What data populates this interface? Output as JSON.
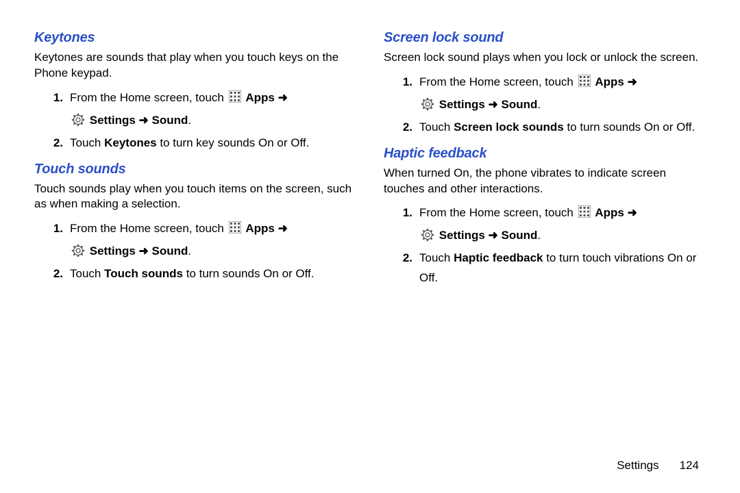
{
  "footer": {
    "section": "Settings",
    "page": "124"
  },
  "arrow": "➜",
  "left": {
    "s1": {
      "heading": "Keytones",
      "desc": "Keytones are sounds that play when you touch keys on the Phone keypad.",
      "step1_prefix": "From the Home screen, touch ",
      "apps_label": "Apps",
      "settings_label": "Settings",
      "sound_label": "Sound",
      "step2_a": "Touch ",
      "step2_bold": "Keytones",
      "step2_b": " to turn key sounds On or Off."
    },
    "s2": {
      "heading": "Touch sounds",
      "desc": "Touch sounds play when you touch items on the screen, such as when making a selection.",
      "step1_prefix": "From the Home screen, touch ",
      "apps_label": "Apps",
      "settings_label": "Settings",
      "sound_label": "Sound",
      "step2_a": "Touch ",
      "step2_bold": "Touch sounds",
      "step2_b": " to turn sounds On or Off."
    }
  },
  "right": {
    "s1": {
      "heading": "Screen lock sound",
      "desc": "Screen lock sound plays when you lock or unlock the screen.",
      "step1_prefix": "From the Home screen, touch ",
      "apps_label": "Apps",
      "settings_label": "Settings",
      "sound_label": "Sound",
      "step2_a": "Touch ",
      "step2_bold": "Screen lock sounds",
      "step2_b": " to turn sounds On or Off."
    },
    "s2": {
      "heading": "Haptic feedback",
      "desc": "When turned On, the phone vibrates to indicate screen touches and other interactions.",
      "step1_prefix": "From the Home screen, touch ",
      "apps_label": "Apps",
      "settings_label": "Settings",
      "sound_label": "Sound",
      "step2_a": "Touch ",
      "step2_bold": "Haptic feedback",
      "step2_b": " to turn touch vibrations On or Off."
    }
  }
}
